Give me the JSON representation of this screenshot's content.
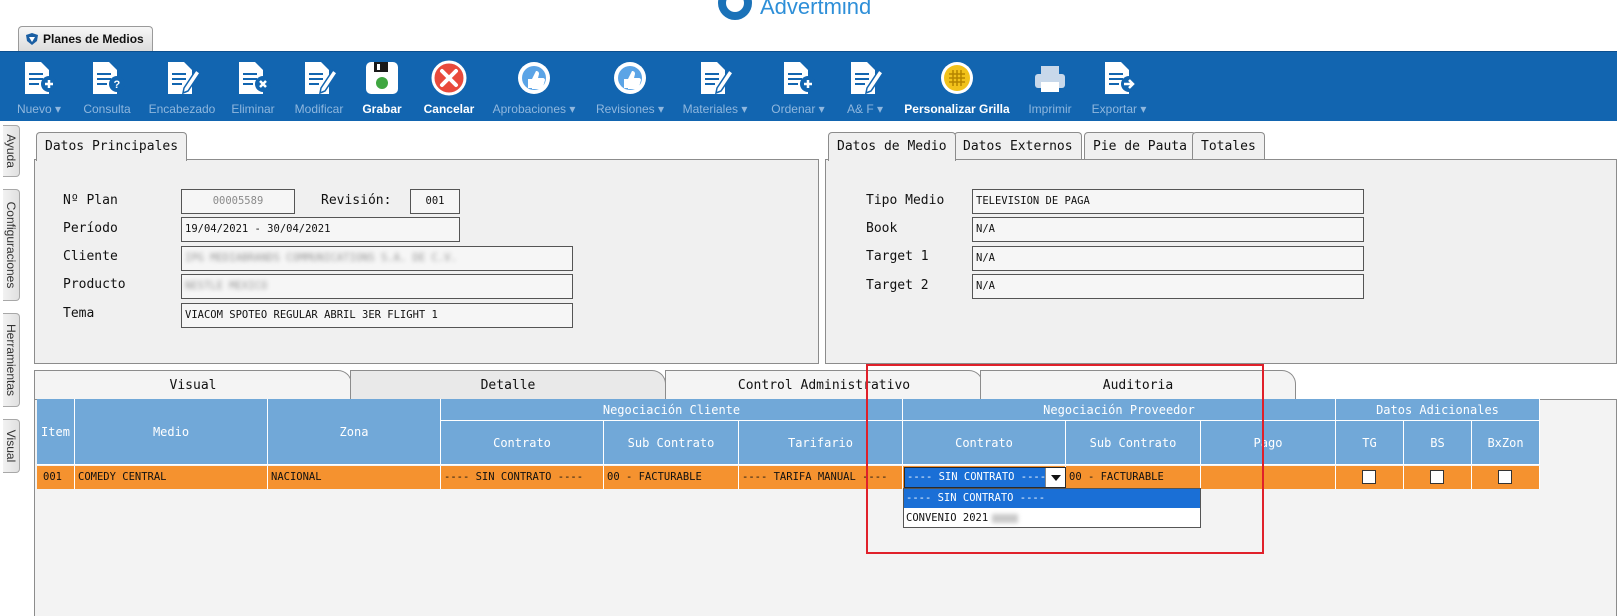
{
  "brand": {
    "logo_text": "Advertmind",
    "logo_text_bold": "ind"
  },
  "module_tab": {
    "label": "Planes de Medios"
  },
  "toolbar": {
    "items": [
      {
        "label": "Nuevo",
        "caret": true,
        "active": false,
        "icon": "doc-add-icon"
      },
      {
        "label": "Consulta",
        "caret": false,
        "active": false,
        "icon": "doc-query-icon"
      },
      {
        "label": "Encabezado",
        "caret": false,
        "active": false,
        "icon": "doc-edit-icon"
      },
      {
        "label": "Eliminar",
        "caret": false,
        "active": false,
        "icon": "doc-delete-icon"
      },
      {
        "label": "Modificar",
        "caret": false,
        "active": false,
        "icon": "doc-edit-icon"
      },
      {
        "label": "Grabar",
        "caret": false,
        "active": true,
        "icon": "floppy-save-icon"
      },
      {
        "label": "Cancelar",
        "caret": false,
        "active": true,
        "icon": "cancel-icon"
      },
      {
        "label": "Aprobaciones",
        "caret": true,
        "active": false,
        "icon": "thumbs-up-icon"
      },
      {
        "label": "Revisiones",
        "caret": true,
        "active": false,
        "icon": "thumbs-up-icon"
      },
      {
        "label": "Materiales",
        "caret": true,
        "active": false,
        "icon": "doc-edit-icon"
      },
      {
        "label": "Ordenar",
        "caret": true,
        "active": false,
        "icon": "doc-add-icon"
      },
      {
        "label": "A& F",
        "caret": true,
        "active": false,
        "icon": "doc-edit-icon"
      },
      {
        "label": "Personalizar Grilla",
        "caret": false,
        "active": true,
        "icon": "grid-icon"
      },
      {
        "label": "Imprimir",
        "caret": false,
        "active": false,
        "icon": "printer-icon"
      },
      {
        "label": "Exportar",
        "caret": true,
        "active": false,
        "icon": "doc-export-icon"
      }
    ]
  },
  "side_tabs": [
    "Ayuda",
    "Configuraciones",
    "Herramientas",
    "Visual"
  ],
  "datos_principales": {
    "tab_label": "Datos Principales",
    "labels": {
      "plan": "Nº Plan",
      "revision": "Revisión:",
      "periodo": "Período",
      "cliente": "Cliente",
      "producto": "Producto",
      "tema": "Tema"
    },
    "values": {
      "plan": "00005589",
      "revision": "001",
      "periodo": "19/04/2021 - 30/04/2021",
      "cliente": "IPG MEDIABRANDS COMMUNICATIONS S.A. DE C.V.",
      "producto": "NESTLE MEXICO",
      "tema": "VIACOM SPOTEO REGULAR ABRIL 3ER FLIGHT 1"
    }
  },
  "datos_medio": {
    "tabs": [
      "Datos de Medio",
      "Datos Externos",
      "Pie de Pauta",
      "Totales"
    ],
    "labels": {
      "tipo_medio": "Tipo Medio",
      "book": "Book",
      "target1": "Target 1",
      "target2": "Target 2"
    },
    "values": {
      "tipo_medio": "TELEVISION DE PAGA",
      "book": "N/A",
      "target1": "N/A",
      "target2": "N/A"
    }
  },
  "detail_tabs": [
    "Visual",
    "Detalle",
    "Control Administrativo",
    "Auditoria"
  ],
  "grid": {
    "group_headers": {
      "cliente": "Negociación Cliente",
      "proveedor": "Negociación Proveedor",
      "adicionales": "Datos Adicionales"
    },
    "headers": {
      "item": "Item",
      "medio": "Medio",
      "zona": "Zona",
      "c_contrato": "Contrato",
      "c_sub": "Sub Contrato",
      "c_tarifario": "Tarifario",
      "p_contrato": "Contrato",
      "p_sub": "Sub Contrato",
      "p_pago": "Pago",
      "tg": "TG",
      "bs": "BS",
      "bxzon": "BxZon"
    },
    "row": {
      "item": "001",
      "medio": "COMEDY CENTRAL",
      "zona": "NACIONAL",
      "c_contrato": "---- SIN CONTRATO ----",
      "c_sub": "00 - FACTURABLE",
      "c_tarifario": "---- TARIFA MANUAL ----",
      "p_contrato": "---- SIN CONTRATO ----",
      "p_sub": "00 - FACTURABLE",
      "p_pago": ""
    }
  },
  "dropdown": {
    "selected": "---- SIN CONTRATO ----",
    "options": [
      "---- SIN CONTRATO ----",
      "CONVENIO 2021"
    ]
  },
  "colors": {
    "toolbar": "#1265b0",
    "header": "#71a8d8",
    "row": "#f5922f",
    "highlight": "#e0202a",
    "selection": "#1a6fd6"
  }
}
